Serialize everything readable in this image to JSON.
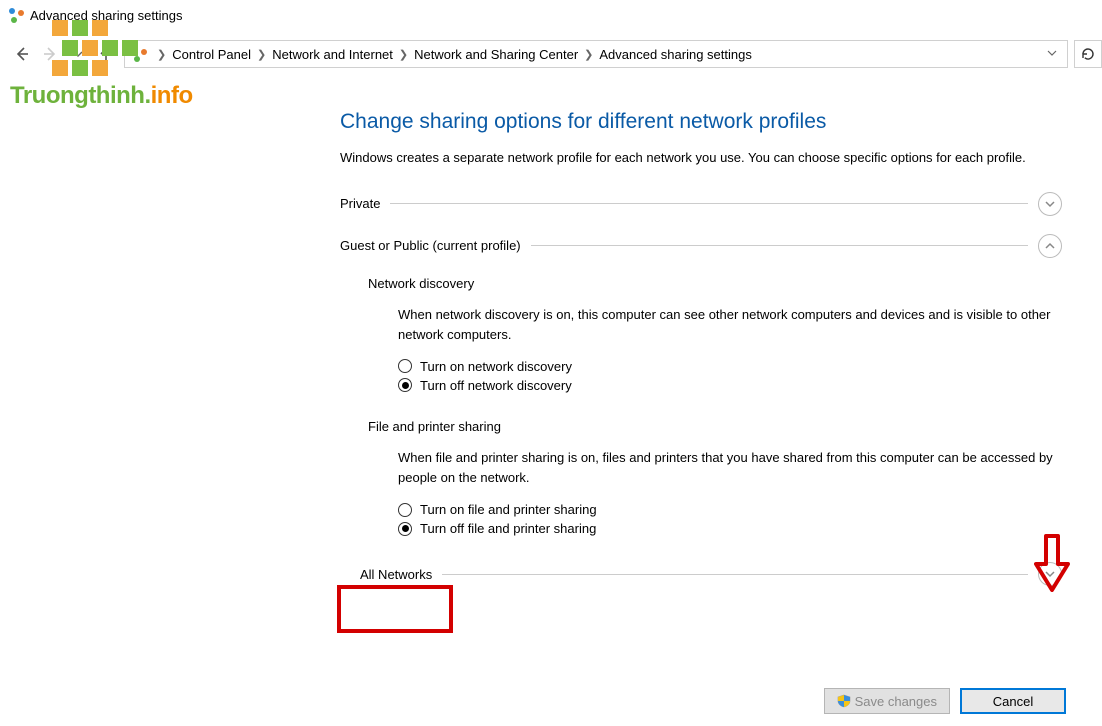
{
  "window": {
    "title": "Advanced sharing settings"
  },
  "breadcrumbs": {
    "b0": "Control Panel",
    "b1": "Network and Internet",
    "b2": "Network and Sharing Center",
    "b3": "Advanced sharing settings"
  },
  "page": {
    "heading": "Change sharing options for different network profiles",
    "intro": "Windows creates a separate network profile for each network you use. You can choose specific options for each profile."
  },
  "sections": {
    "private": {
      "label": "Private"
    },
    "guest": {
      "label": "Guest or Public (current profile)"
    },
    "all": {
      "label": "All Networks"
    }
  },
  "netdisc": {
    "title": "Network discovery",
    "desc": "When network discovery is on, this computer can see other network computers and devices and is visible to other network computers.",
    "opt_on": "Turn on network discovery",
    "opt_off": "Turn off network discovery"
  },
  "fps": {
    "title": "File and printer sharing",
    "desc": "When file and printer sharing is on, files and printers that you have shared from this computer can be accessed by people on the network.",
    "opt_on": "Turn on file and printer sharing",
    "opt_off": "Turn off file and printer sharing"
  },
  "buttons": {
    "save": "Save changes",
    "cancel": "Cancel"
  },
  "watermark": {
    "part1": "Truongthinh.",
    "part2": "info"
  }
}
